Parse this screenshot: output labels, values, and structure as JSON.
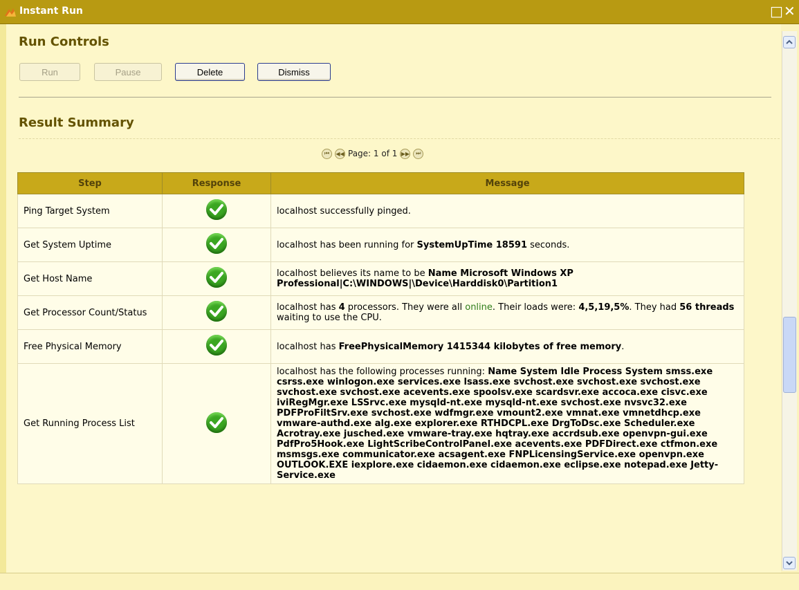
{
  "window": {
    "title": "Instant Run",
    "logo_icon": "app-logo-icon",
    "maximize_icon": "maximize-icon",
    "close_icon": "close-icon"
  },
  "run_controls": {
    "heading": "Run Controls",
    "buttons": [
      {
        "label": "Run",
        "enabled": false
      },
      {
        "label": "Pause",
        "enabled": false
      },
      {
        "label": "Delete",
        "enabled": true
      },
      {
        "label": "Dismiss",
        "enabled": true
      }
    ]
  },
  "result_summary": {
    "heading": "Result Summary",
    "pager": {
      "label": "Page: 1 of 1"
    },
    "columns": [
      "Step",
      "Response",
      "Message"
    ],
    "rows": [
      {
        "step": "Ping Target System",
        "response": "success",
        "message": [
          {
            "t": "localhost successfully pinged."
          }
        ]
      },
      {
        "step": "Get System Uptime",
        "response": "success",
        "message": [
          {
            "t": "localhost has been running for "
          },
          {
            "t": "SystemUpTime 18591",
            "b": true
          },
          {
            "t": " seconds."
          }
        ]
      },
      {
        "step": "Get Host Name",
        "response": "success",
        "message": [
          {
            "t": "localhost believes its name to be "
          },
          {
            "t": "Name Microsoft Windows XP Professional|C:\\WINDOWS|\\Device\\Harddisk0\\Partition1",
            "b": true
          }
        ]
      },
      {
        "step": "Get Processor Count/Status",
        "response": "success",
        "message": [
          {
            "t": "localhost has "
          },
          {
            "t": "4",
            "b": true
          },
          {
            "t": " processors. They were all "
          },
          {
            "t": "online",
            "c": "online"
          },
          {
            "t": ". Their loads were: "
          },
          {
            "t": "4,5,19,5%",
            "b": true
          },
          {
            "t": ". They had "
          },
          {
            "t": "56 threads",
            "b": true
          },
          {
            "t": " waiting to use the CPU."
          }
        ]
      },
      {
        "step": "Free Physical Memory",
        "response": "success",
        "message": [
          {
            "t": "localhost has "
          },
          {
            "t": "FreePhysicalMemory 1415344 kilobytes of free memory",
            "b": true
          },
          {
            "t": "."
          }
        ]
      },
      {
        "step": "Get Running Process List",
        "response": "success",
        "message": [
          {
            "t": "localhost has the following processes running: "
          },
          {
            "t": "Name System Idle Process System smss.exe csrss.exe winlogon.exe services.exe lsass.exe svchost.exe svchost.exe svchost.exe svchost.exe svchost.exe acevents.exe spoolsv.exe scardsvr.exe accoca.exe cisvc.exe iviRegMgr.exe LSSrvc.exe mysqld-nt.exe mysqld-nt.exe svchost.exe nvsvc32.exe PDFProFiltSrv.exe svchost.exe wdfmgr.exe vmount2.exe vmnat.exe vmnetdhcp.exe vmware-authd.exe alg.exe explorer.exe RTHDCPL.exe DrgToDsc.exe Scheduler.exe Acrotray.exe jusched.exe vmware-tray.exe hqtray.exe accrdsub.exe openvpn-gui.exe PdfPro5Hook.exe LightScribeControlPanel.exe acevents.exe PDFDirect.exe ctfmon.exe msmsgs.exe communicator.exe acsagent.exe FNPLicensingService.exe openvpn.exe OUTLOOK.EXE iexplore.exe cidaemon.exe cidaemon.exe eclipse.exe notepad.exe Jetty-Service.exe",
            "b": true
          }
        ]
      }
    ]
  },
  "colors": {
    "title_bar": "#b89a12",
    "header_bg": "#c8a91a",
    "panel_bg": "#fdf7c9",
    "heading_text": "#645300",
    "success": "#3ba622",
    "online_text": "#2f7d1a"
  }
}
